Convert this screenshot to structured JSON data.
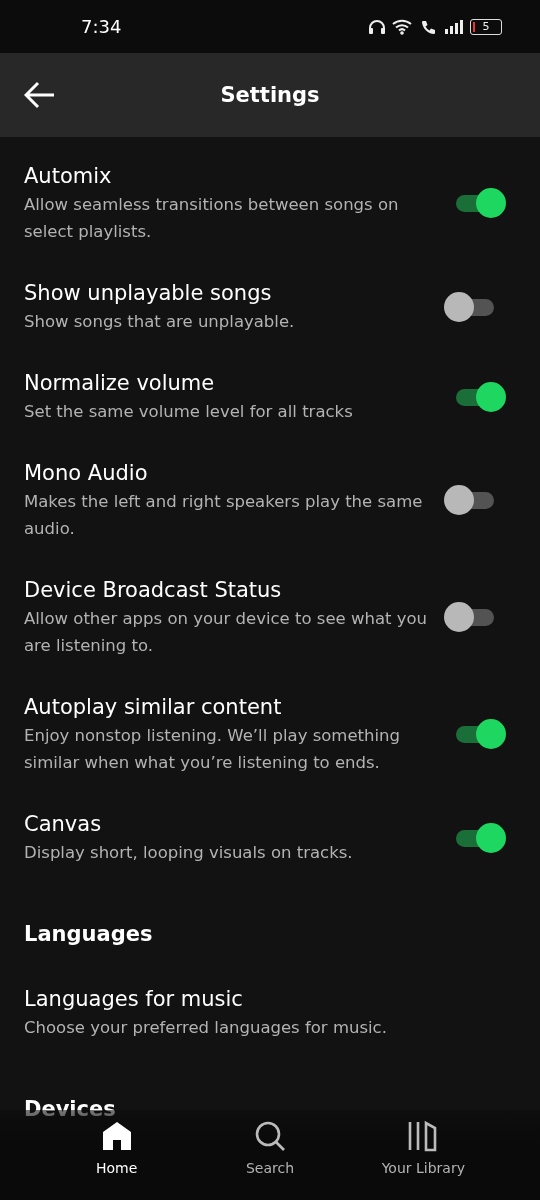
{
  "status_bar": {
    "time": "7:34",
    "battery": "5"
  },
  "header": {
    "title": "Settings"
  },
  "settings": [
    {
      "kind": "toggle",
      "title": "Automix",
      "subtitle": "Allow seamless transitions between songs on select playlists.",
      "on": true
    },
    {
      "kind": "toggle",
      "title": "Show unplayable songs",
      "subtitle": "Show songs that are unplayable.",
      "on": false
    },
    {
      "kind": "toggle",
      "title": "Normalize volume",
      "subtitle": "Set the same volume level for all tracks",
      "on": true
    },
    {
      "kind": "toggle",
      "title": "Mono Audio",
      "subtitle": "Makes the left and right speakers play the same audio.",
      "on": false
    },
    {
      "kind": "toggle",
      "title": "Device Broadcast Status",
      "subtitle": "Allow other apps on your device to see what you are listening to.",
      "on": false
    },
    {
      "kind": "toggle",
      "title": "Autoplay similar content",
      "subtitle": "Enjoy nonstop listening. We’ll play something similar when what you’re listening to ends.",
      "on": true
    },
    {
      "kind": "toggle",
      "title": "Canvas",
      "subtitle": "Display short, looping visuals on tracks.",
      "on": true
    },
    {
      "kind": "section",
      "title": "Languages"
    },
    {
      "kind": "link",
      "title": "Languages for music",
      "subtitle": "Choose your preferred languages for music."
    },
    {
      "kind": "section",
      "title": "Devices"
    }
  ],
  "nav": [
    {
      "kind": "home",
      "label": "Home",
      "selected": true
    },
    {
      "kind": "search",
      "label": "Search",
      "selected": false
    },
    {
      "kind": "library",
      "label": "Your Library",
      "selected": false
    }
  ]
}
